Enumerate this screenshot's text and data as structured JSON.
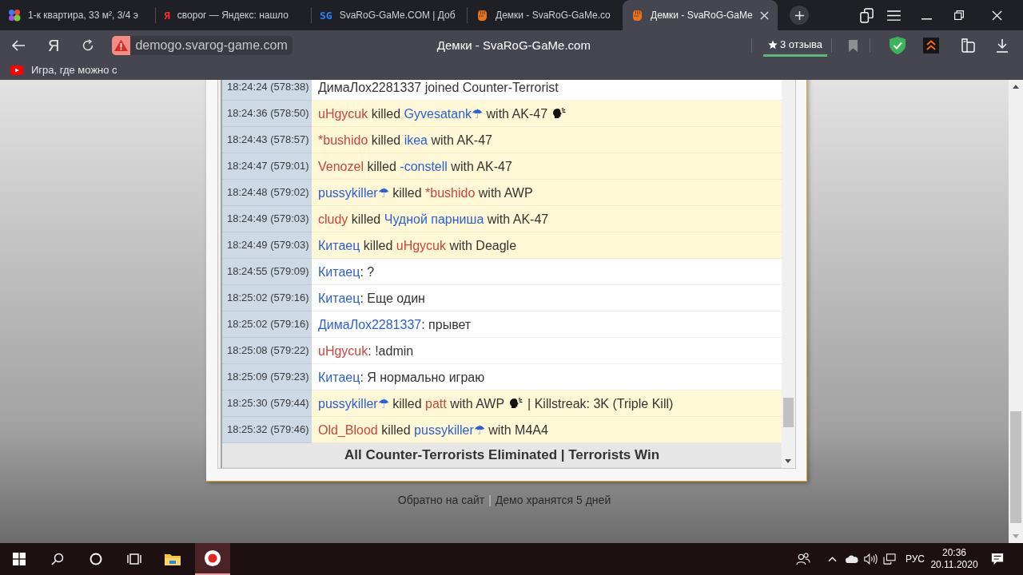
{
  "tabs": [
    {
      "kind": "dots",
      "title": "1-к квартира, 33 м², 3/4 э",
      "selected": false
    },
    {
      "kind": "glyph",
      "glyph": "Я",
      "color": "#ff2a2a",
      "title": "сворог — Яндекс: нашло",
      "selected": false
    },
    {
      "kind": "glyph",
      "glyph": "SG",
      "color": "#1f86ff",
      "title": "SvaRoG-GaMe.COM | Доб",
      "selected": false
    },
    {
      "kind": "fist",
      "title": "Демки - SvaRoG-GaMe.co",
      "selected": false
    },
    {
      "kind": "fist",
      "title": "Демки - SvaRoG-GaMe",
      "selected": true
    }
  ],
  "toolbar": {
    "home_button": "Я",
    "url": "demogo.svarog-game.com",
    "page_title": "Демки - SvaRoG-GaMe.com",
    "reviews": "3 отзыва"
  },
  "bookmarks": [
    {
      "title": "Игра, где можно с"
    }
  ],
  "log": {
    "rows": [
      {
        "time": "18:24:24 (578:38)",
        "kind": "message",
        "parts": [
          {
            "kind": "text",
            "text": "ДимаЛох2281337 joined Counter-Terrorist"
          }
        ]
      },
      {
        "time": "18:24:36 (578:50)",
        "kind": "kill",
        "parts": [
          {
            "kind": "t",
            "text": "uHgycuk"
          },
          {
            "kind": "text",
            "text": " killed "
          },
          {
            "kind": "ct",
            "text": "Gyvesatank☂"
          },
          {
            "kind": "text",
            "text": " with AK-47"
          },
          {
            "kind": "headshot"
          }
        ]
      },
      {
        "time": "18:24:43 (578:57)",
        "kind": "kill",
        "parts": [
          {
            "kind": "t",
            "text": "*bushido"
          },
          {
            "kind": "text",
            "text": " killed "
          },
          {
            "kind": "ct",
            "text": "ikea"
          },
          {
            "kind": "text",
            "text": " with AK-47"
          }
        ]
      },
      {
        "time": "18:24:47 (579:01)",
        "kind": "kill",
        "parts": [
          {
            "kind": "t",
            "text": "Venozel"
          },
          {
            "kind": "text",
            "text": " killed "
          },
          {
            "kind": "ct",
            "text": "-constell"
          },
          {
            "kind": "text",
            "text": " with AK-47"
          }
        ]
      },
      {
        "time": "18:24:48 (579:02)",
        "kind": "kill",
        "parts": [
          {
            "kind": "ct",
            "text": "pussykiller☂"
          },
          {
            "kind": "text",
            "text": " killed "
          },
          {
            "kind": "t",
            "text": "*bushido"
          },
          {
            "kind": "text",
            "text": " with AWP"
          }
        ]
      },
      {
        "time": "18:24:49 (579:03)",
        "kind": "kill",
        "parts": [
          {
            "kind": "t",
            "text": "cludy"
          },
          {
            "kind": "text",
            "text": " killed "
          },
          {
            "kind": "ct",
            "text": "Чудной парниша"
          },
          {
            "kind": "text",
            "text": " with AK-47"
          }
        ]
      },
      {
        "time": "18:24:49 (579:03)",
        "kind": "kill",
        "parts": [
          {
            "kind": "ct",
            "text": "Китаец"
          },
          {
            "kind": "text",
            "text": " killed "
          },
          {
            "kind": "t",
            "text": "uHgycuk"
          },
          {
            "kind": "text",
            "text": " with Deagle"
          }
        ]
      },
      {
        "time": "18:24:55 (579:09)",
        "kind": "message",
        "parts": [
          {
            "kind": "ct",
            "text": "Китаец"
          },
          {
            "kind": "text",
            "text": ": ?"
          }
        ]
      },
      {
        "time": "18:25:02 (579:16)",
        "kind": "message",
        "parts": [
          {
            "kind": "ct",
            "text": "Китаец"
          },
          {
            "kind": "text",
            "text": ": Еще один"
          }
        ]
      },
      {
        "time": "18:25:02 (579:16)",
        "kind": "message",
        "parts": [
          {
            "kind": "ct",
            "text": "ДимаЛох2281337"
          },
          {
            "kind": "text",
            "text": ": прывет"
          }
        ]
      },
      {
        "time": "18:25:08 (579:22)",
        "kind": "message",
        "parts": [
          {
            "kind": "t",
            "text": "uHgycuk"
          },
          {
            "kind": "text",
            "text": ": !admin"
          }
        ]
      },
      {
        "time": "18:25:09 (579:23)",
        "kind": "message",
        "parts": [
          {
            "kind": "ct",
            "text": "Китаец"
          },
          {
            "kind": "text",
            "text": ": Я нормально играю"
          }
        ]
      },
      {
        "time": "18:25:30 (579:44)",
        "kind": "kill",
        "parts": [
          {
            "kind": "ct",
            "text": "pussykiller☂"
          },
          {
            "kind": "text",
            "text": " killed "
          },
          {
            "kind": "t",
            "text": "patt"
          },
          {
            "kind": "text",
            "text": " with AWP"
          },
          {
            "kind": "headshot"
          },
          {
            "kind": "text",
            "text": "| Killstreak: 3K (Triple Kill)"
          }
        ]
      },
      {
        "time": "18:25:32 (579:46)",
        "kind": "kill",
        "parts": [
          {
            "kind": "t",
            "text": "Old_Blood"
          },
          {
            "kind": "text",
            "text": " killed "
          },
          {
            "kind": "ct",
            "text": "pussykiller☂"
          },
          {
            "kind": "text",
            "text": " with M4A4"
          }
        ]
      },
      {
        "kind": "round_end",
        "parts": [
          {
            "kind": "text",
            "text": "All Counter-Terrorists Eliminated | Terrorists Win"
          }
        ]
      }
    ]
  },
  "footer": {
    "back_link": "Обратно на сайт",
    "separator": "|",
    "note": "Демо хранятся 5 дней"
  },
  "taskbar": {
    "buttons": [
      {
        "kind": "start",
        "selected": false
      },
      {
        "kind": "search",
        "selected": false
      },
      {
        "kind": "cortana",
        "selected": false
      },
      {
        "kind": "task_view",
        "selected": false
      },
      {
        "kind": "explorer",
        "selected": false
      },
      {
        "kind": "browser",
        "selected": true
      }
    ],
    "language": "РУС",
    "time": "20:36",
    "date": "20.11.2020"
  }
}
